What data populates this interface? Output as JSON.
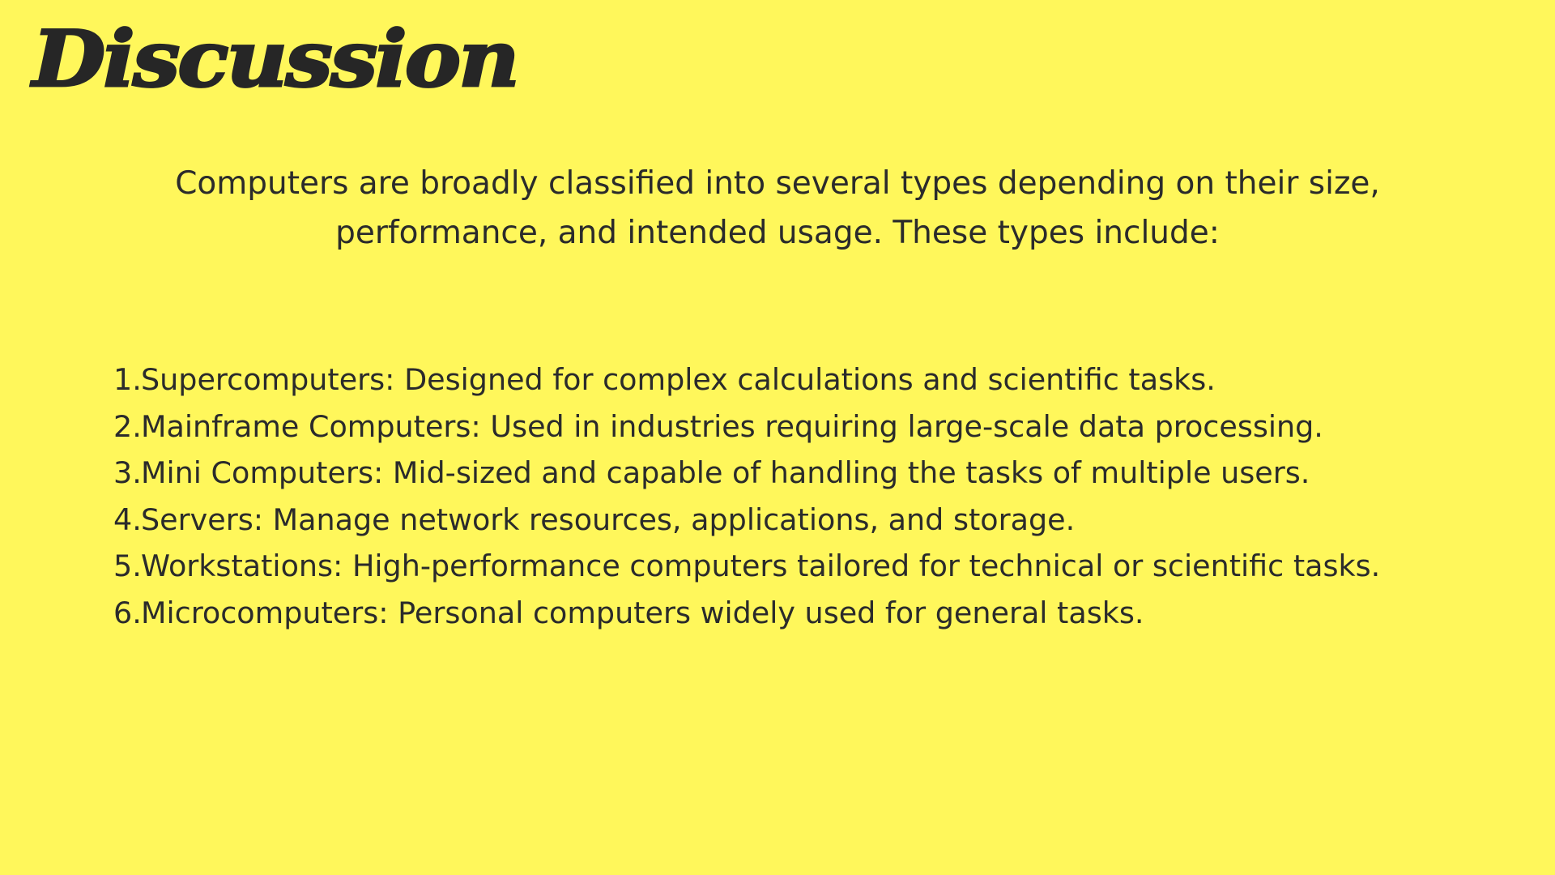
{
  "slide": {
    "title": "Discussion",
    "intro": "Computers are broadly classified into several types depending on their size, performance, and intended usage. These types include:",
    "types": [
      {
        "number": "1.",
        "text": "Supercomputers: Designed for complex calculations and scientific tasks."
      },
      {
        "number": "2.",
        "text": "Mainframe Computers: Used in industries requiring large-scale data processing."
      },
      {
        "number": "3.",
        "text": "Mini Computers: Mid-sized and capable of handling the tasks of multiple users."
      },
      {
        "number": "4.",
        "text": "Servers: Manage network resources, applications, and storage."
      },
      {
        "number": "5.",
        "text": "Workstations: High-performance computers tailored for technical or scientific tasks."
      },
      {
        "number": "6.",
        "text": "Microcomputers: Personal computers widely used for general tasks."
      }
    ]
  },
  "colors": {
    "background": "#fff75b",
    "text": "#2b2b2b"
  }
}
